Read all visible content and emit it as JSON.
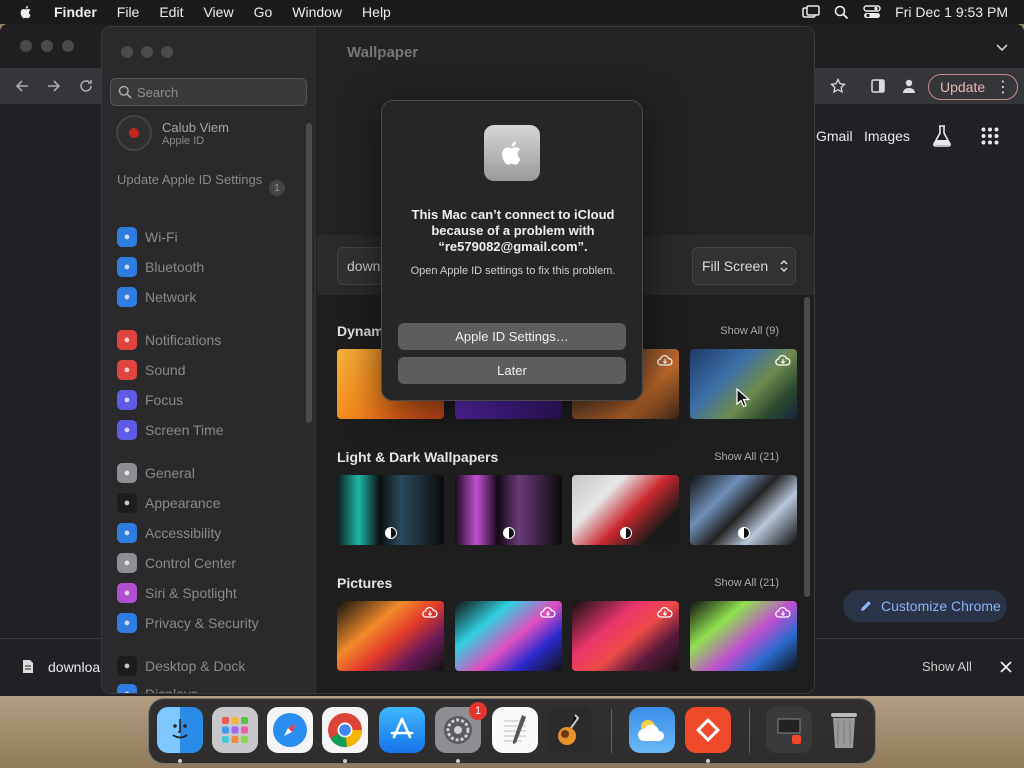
{
  "menubar": {
    "app": "Finder",
    "items": [
      "File",
      "Edit",
      "View",
      "Go",
      "Window",
      "Help"
    ],
    "clock": "Fri Dec 1  9:53 PM"
  },
  "chrome": {
    "update_label": "Update",
    "gmail": "Gmail",
    "images": "Images",
    "customize": "Customize Chrome",
    "download_name": "downloa",
    "show_all": "Show All"
  },
  "settings": {
    "search_placeholder": "Search",
    "profile": {
      "name": "Calub Viem",
      "sub": "Apple ID"
    },
    "update_apple_id": "Update Apple ID Settings",
    "update_badge": "1",
    "sidebar": [
      {
        "label": "Wi-Fi",
        "color": "#2f7de1",
        "icon": "wifi-icon"
      },
      {
        "label": "Bluetooth",
        "color": "#2f7de1",
        "icon": "bluetooth-icon"
      },
      {
        "label": "Network",
        "color": "#2f7de1",
        "icon": "globe-icon"
      },
      {
        "label": "Notifications",
        "color": "#e0443e",
        "icon": "bell-icon"
      },
      {
        "label": "Sound",
        "color": "#e0443e",
        "icon": "speaker-icon"
      },
      {
        "label": "Focus",
        "color": "#5e5ce6",
        "icon": "moon-icon"
      },
      {
        "label": "Screen Time",
        "color": "#5e5ce6",
        "icon": "hourglass-icon"
      },
      {
        "label": "General",
        "color": "#8e8e93",
        "icon": "gear-icon"
      },
      {
        "label": "Appearance",
        "color": "#1c1c1e",
        "icon": "appearance-icon"
      },
      {
        "label": "Accessibility",
        "color": "#2f7de1",
        "icon": "accessibility-icon"
      },
      {
        "label": "Control Center",
        "color": "#8e8e93",
        "icon": "control-center-icon"
      },
      {
        "label": "Siri & Spotlight",
        "color": "#b04fd0",
        "icon": "siri-icon"
      },
      {
        "label": "Privacy & Security",
        "color": "#2f7de1",
        "icon": "hand-icon"
      },
      {
        "label": "Desktop & Dock",
        "color": "#1c1c1e",
        "icon": "dock-icon"
      },
      {
        "label": "Displays",
        "color": "#2f7de1",
        "icon": "display-icon"
      }
    ],
    "pane_title": "Wallpaper",
    "current_wallpaper": "downl",
    "fit_option": "Fill Screen",
    "sections": [
      {
        "title": "Dynami",
        "show_all": "Show All (9)"
      },
      {
        "title": "Light & Dark Wallpapers",
        "show_all": "Show All (21)"
      },
      {
        "title": "Pictures",
        "show_all": "Show All (21)"
      }
    ]
  },
  "dialog": {
    "message": "This Mac can’t connect to iCloud because of a problem with “re579082@gmail.com”.",
    "info": "Open Apple ID settings to fix this problem.",
    "primary": "Apple ID Settings…",
    "secondary": "Later"
  },
  "dock": {
    "badge": "1",
    "apps": [
      "Finder",
      "Launchpad",
      "Safari",
      "Chrome",
      "App Store",
      "System Settings",
      "TextEdit",
      "GarageBand",
      "Weather",
      "AnyDesk",
      "Downloads",
      "Trash"
    ]
  }
}
